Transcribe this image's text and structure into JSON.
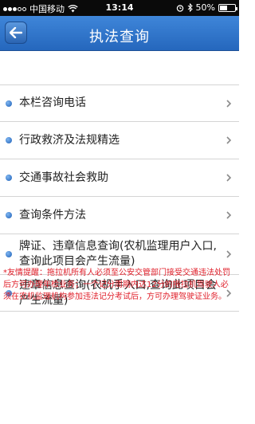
{
  "status_bar": {
    "carrier": "中国移动",
    "time": "13:14",
    "battery_percent_label": "50%",
    "battery_level": 0.5
  },
  "nav": {
    "title": "执法查询",
    "back_icon": "back-arrow-icon"
  },
  "list": {
    "items": [
      {
        "label": "本栏咨询电话"
      },
      {
        "label": "行政救济及法规精选"
      },
      {
        "label": "交通事故社会救助"
      },
      {
        "label": "查询条件方法"
      },
      {
        "label": "牌证、违章信息查询(农机监理用户入口,查询此项目会产生流量)"
      },
      {
        "label": "违章信息查询(农机手入口,查询此项目会产生流量)"
      }
    ]
  },
  "notice": {
    "text": "*友情提醒：拖拉机所有人必须至公安交管部门接受交通违法处罚后方可办理年检业务；一个记分周期内达12分的拖拉机驾驶人必须在农机监理机构参加违法记分考试后，方可办理驾驶证业务。"
  },
  "colors": {
    "nav_bar": "#2f74cc",
    "notice_text": "#e0202b",
    "bullet": "#1d5fb8"
  }
}
